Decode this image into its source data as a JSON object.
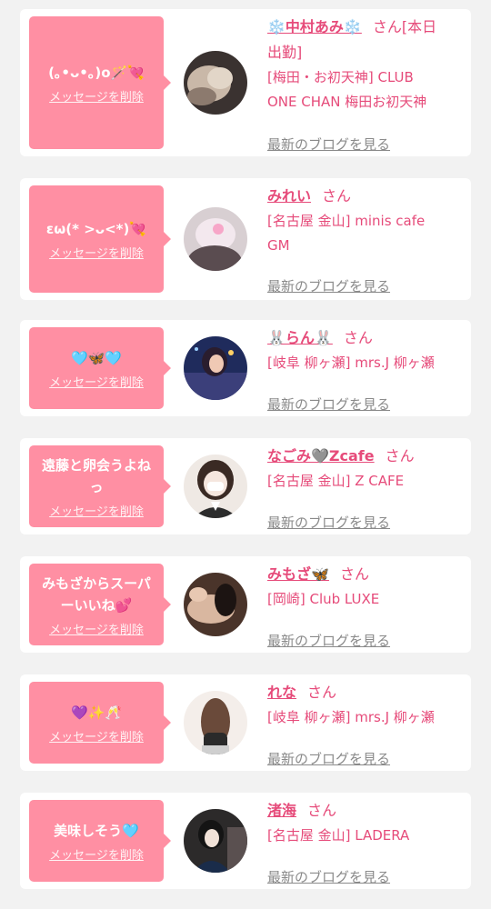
{
  "colors": {
    "accent": "#e64b7a",
    "bubble": "#ff8fa3",
    "link_gray": "#8a8a8a"
  },
  "common": {
    "delete_label": "メッセージを削除",
    "blog_label": "最新のブログを見る"
  },
  "items": [
    {
      "message": "(｡•ᴗ•｡)ο🪄💘",
      "name": "❄️中村あみ❄️",
      "suffix": "さん[本日出勤]",
      "name_line2": "出勤]",
      "shop_lines": [
        "[梅田・お初天神] CLUB",
        "ONE CHAN 梅田お初天神"
      ]
    },
    {
      "message": "εω(* >ᴗ<*)💘",
      "name": "みれい",
      "suffix": "さん",
      "shop_lines": [
        "[名古屋 金山] minis cafe",
        "GM"
      ]
    },
    {
      "message": "🩵🦋🩵",
      "name": "🐰らん🐰",
      "suffix": "さん",
      "shop_lines": [
        "[岐阜 柳ヶ瀬] mrs.J 柳ヶ瀬"
      ]
    },
    {
      "message_lines": [
        "遠藤と卵会うよね",
        "っ"
      ],
      "name": "なごみ🩶Zcafe",
      "suffix": "さん",
      "shop_lines": [
        "[名古屋 金山] Z CAFE"
      ]
    },
    {
      "message_lines": [
        "みもざからスーパ",
        "ーいいね💕"
      ],
      "name": "みもざ🦋",
      "suffix": "さん",
      "shop_lines": [
        "[岡崎] Club LUXE"
      ]
    },
    {
      "message": "💜✨🥂",
      "name": "れな",
      "suffix": "さん",
      "shop_lines": [
        "[岐阜 柳ヶ瀬] mrs.J 柳ヶ瀬"
      ]
    },
    {
      "message": "美味しそう🩵",
      "name": "渚海",
      "suffix": "さん",
      "shop_lines": [
        "[名古屋 金山] LADERA"
      ]
    }
  ]
}
